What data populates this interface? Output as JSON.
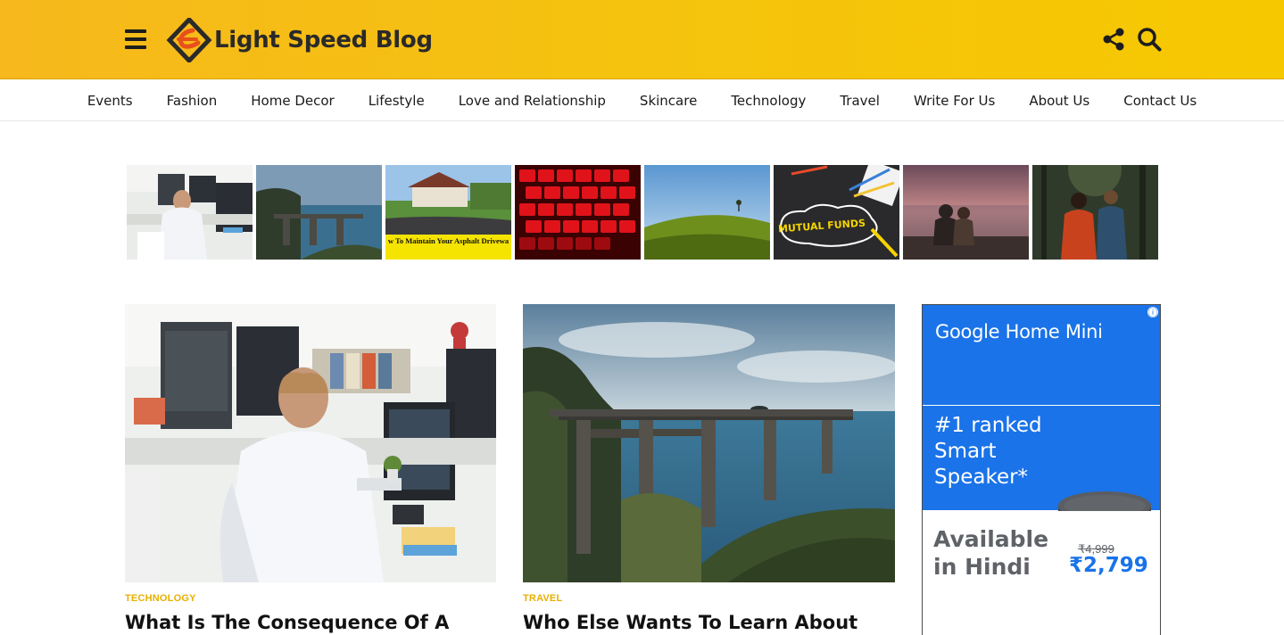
{
  "site": {
    "title": "Light Speed Blog",
    "brand_color": "#f5c30e",
    "accent_color": "#e8b000"
  },
  "header": {
    "menu_icon": "hamburger-icon",
    "share_icon": "share-icon",
    "search_icon": "search-icon"
  },
  "nav": {
    "items": [
      {
        "label": "Events"
      },
      {
        "label": "Fashion"
      },
      {
        "label": "Home Decor"
      },
      {
        "label": "Lifestyle"
      },
      {
        "label": "Love and Relationship"
      },
      {
        "label": "Skincare"
      },
      {
        "label": "Technology"
      },
      {
        "label": "Travel"
      },
      {
        "label": "Write For Us"
      },
      {
        "label": "About Us"
      },
      {
        "label": "Contact Us"
      }
    ]
  },
  "strip": {
    "thumbs": [
      {
        "name": "office-thumb"
      },
      {
        "name": "bridge-thumb"
      },
      {
        "name": "driveway-thumb",
        "caption": "w To Maintain Your Asphalt Drivewa"
      },
      {
        "name": "keyboard-thumb"
      },
      {
        "name": "field-thumb"
      },
      {
        "name": "mutual-funds-thumb",
        "caption": "MUTUAL FUNDS"
      },
      {
        "name": "sunset-couple-thumb"
      },
      {
        "name": "forest-couple-thumb"
      }
    ]
  },
  "posts": [
    {
      "category": "TECHNOLOGY",
      "title": "What Is The Consequence Of A"
    },
    {
      "category": "TRAVEL",
      "title": "Who Else Wants To Learn About Main"
    }
  ],
  "ad": {
    "brand": "Google Home Mini",
    "headline": "#1 ranked Smart Speaker*",
    "subline": "Available in Hindi",
    "old_price": "₹4,999",
    "new_price": "₹2,799",
    "info_label": "ⓘ",
    "color": "#1a73e8"
  }
}
